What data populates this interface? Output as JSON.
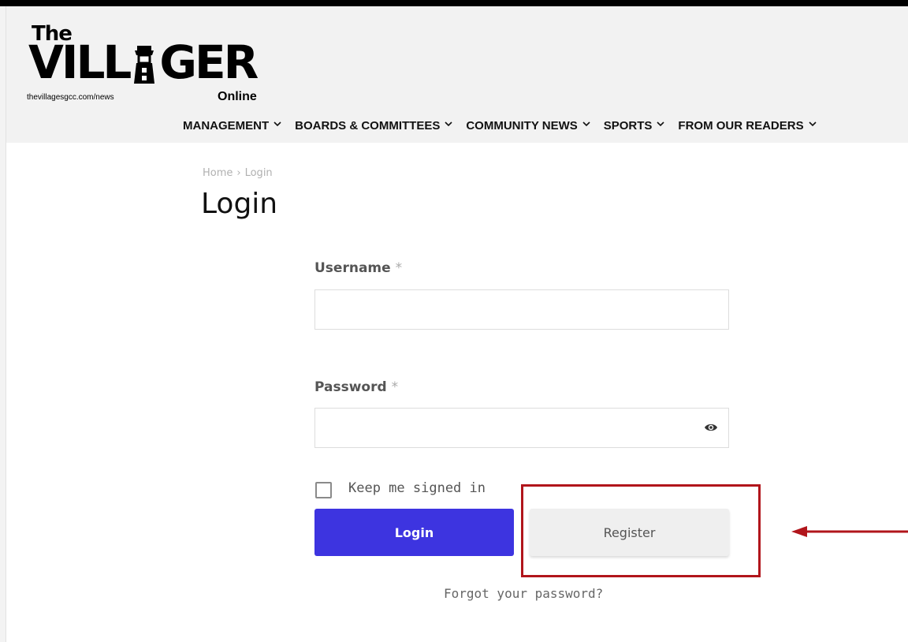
{
  "header": {
    "logo": {
      "the": "The",
      "villager": "VILLAGER",
      "url": "thevillagesgcc.com/news",
      "online": "Online"
    },
    "nav": [
      {
        "label": "MANAGEMENT",
        "icon": "chevron-down-icon"
      },
      {
        "label": "BOARDS & COMMITTEES",
        "icon": "chevron-down-icon"
      },
      {
        "label": "COMMUNITY NEWS",
        "icon": "chevron-down-icon"
      },
      {
        "label": "SPORTS",
        "icon": "chevron-down-icon"
      },
      {
        "label": "FROM OUR READERS",
        "icon": "chevron-down-icon"
      }
    ]
  },
  "breadcrumb": {
    "home": "Home",
    "separator": "›",
    "current": "Login"
  },
  "page_title": "Login",
  "form": {
    "username": {
      "label": "Username",
      "required_mark": "*",
      "value": ""
    },
    "password": {
      "label": "Password",
      "required_mark": "*",
      "value": "",
      "toggle_icon": "eye-icon"
    },
    "keep_signed_in": {
      "label": "Keep me signed in",
      "checked": false
    },
    "login_button": "Login",
    "register_button": "Register",
    "forgot_link": "Forgot your password?"
  },
  "colors": {
    "login_button": "#3d34e0",
    "register_button": "#efefef",
    "highlight": "#b1151b",
    "header_bg": "#f2f2f2"
  }
}
